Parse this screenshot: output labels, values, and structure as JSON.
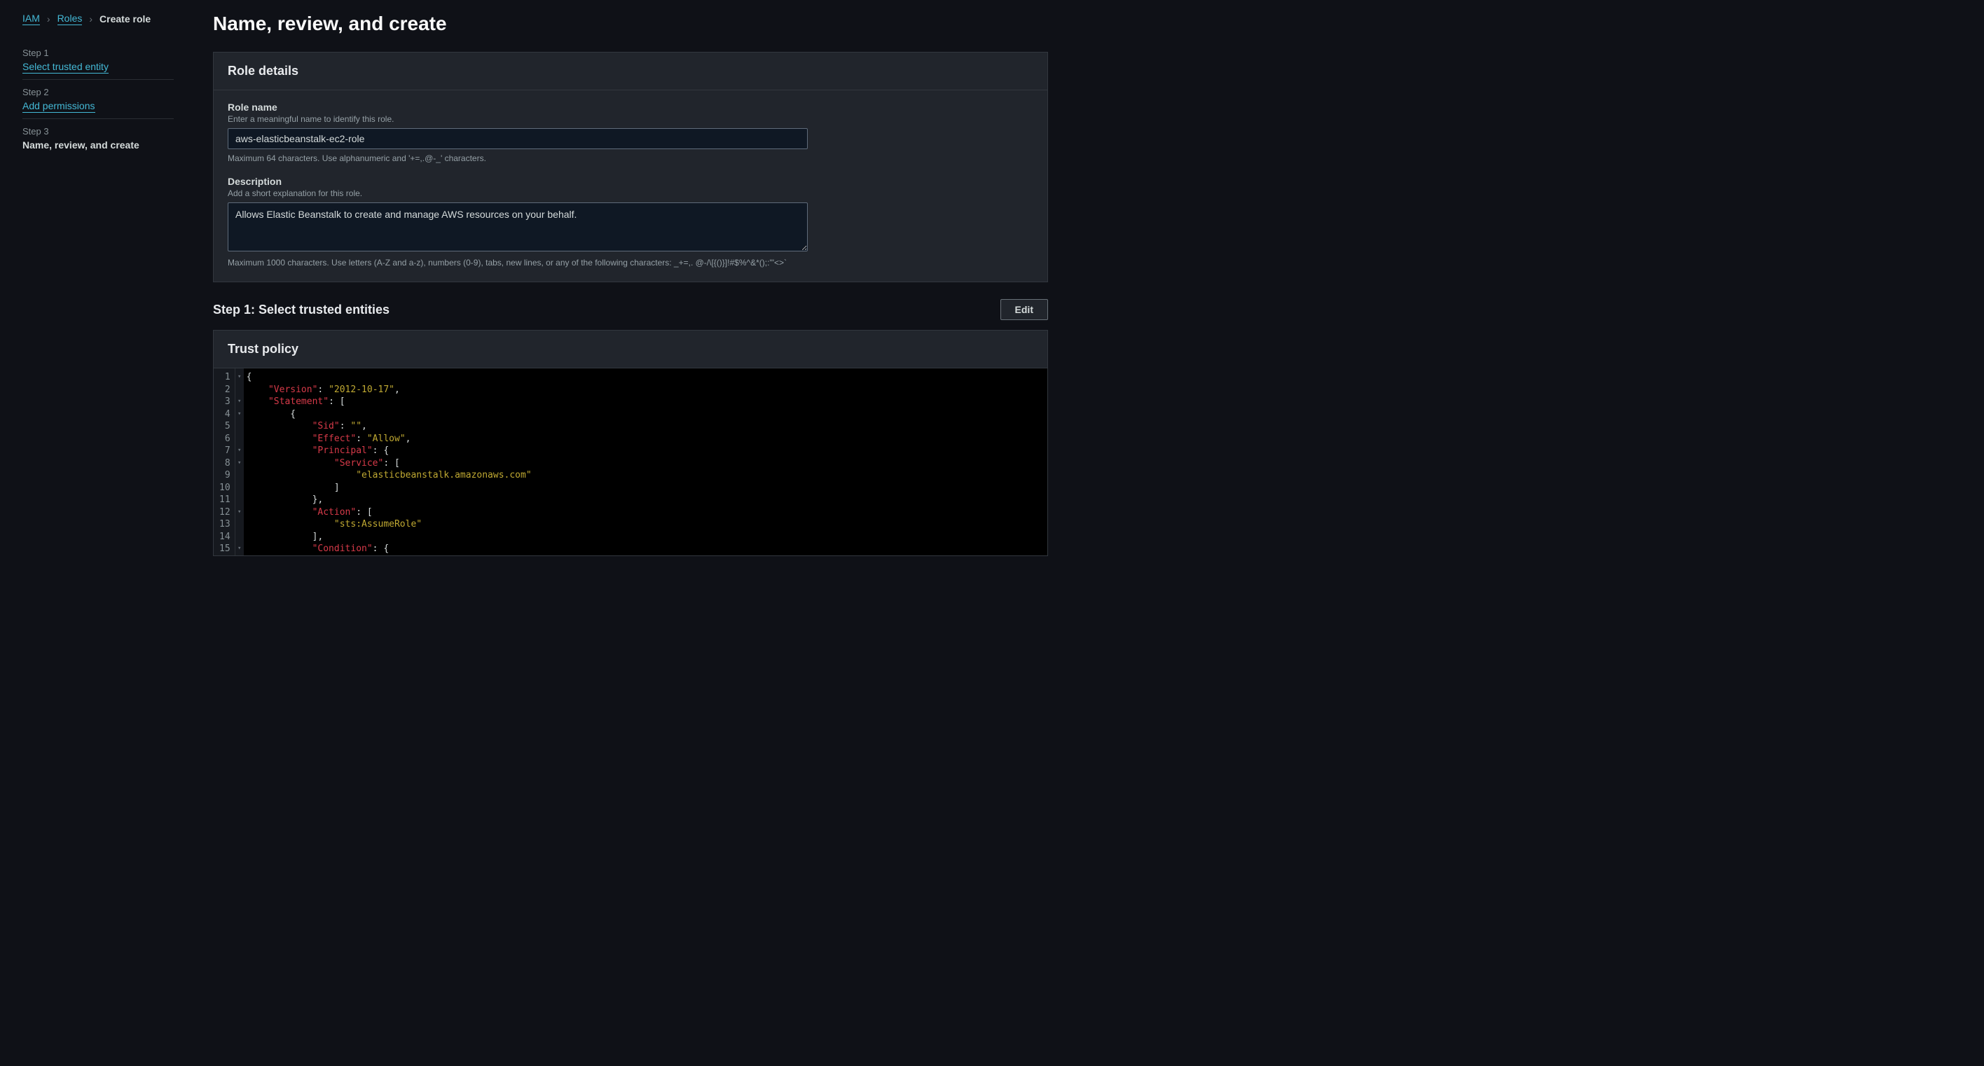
{
  "breadcrumb": {
    "iam": "IAM",
    "roles": "Roles",
    "current": "Create role"
  },
  "steps": [
    {
      "label": "Step 1",
      "name": "Select trusted entity",
      "link": true
    },
    {
      "label": "Step 2",
      "name": "Add permissions",
      "link": true
    },
    {
      "label": "Step 3",
      "name": "Name, review, and create",
      "link": false
    }
  ],
  "page_title": "Name, review, and create",
  "role_details": {
    "heading": "Role details",
    "name_label": "Role name",
    "name_hint": "Enter a meaningful name to identify this role.",
    "name_value": "aws-elasticbeanstalk-ec2-role",
    "name_constraint": "Maximum 64 characters. Use alphanumeric and '+=,.@-_' characters.",
    "desc_label": "Description",
    "desc_hint": "Add a short explanation for this role.",
    "desc_value": "Allows Elastic Beanstalk to create and manage AWS resources on your behalf.",
    "desc_constraint": "Maximum 1000 characters. Use letters (A-Z and a-z), numbers (0-9), tabs, new lines, or any of the following characters: _+=,. @-/\\[{()}]!#$%^&*();:'\"<>`"
  },
  "step1_section": {
    "title": "Step 1: Select trusted entities",
    "edit_label": "Edit"
  },
  "trust_policy": {
    "heading": "Trust policy",
    "line_count": 15,
    "fold_lines": [
      1,
      3,
      4,
      7,
      8,
      12,
      15
    ]
  }
}
